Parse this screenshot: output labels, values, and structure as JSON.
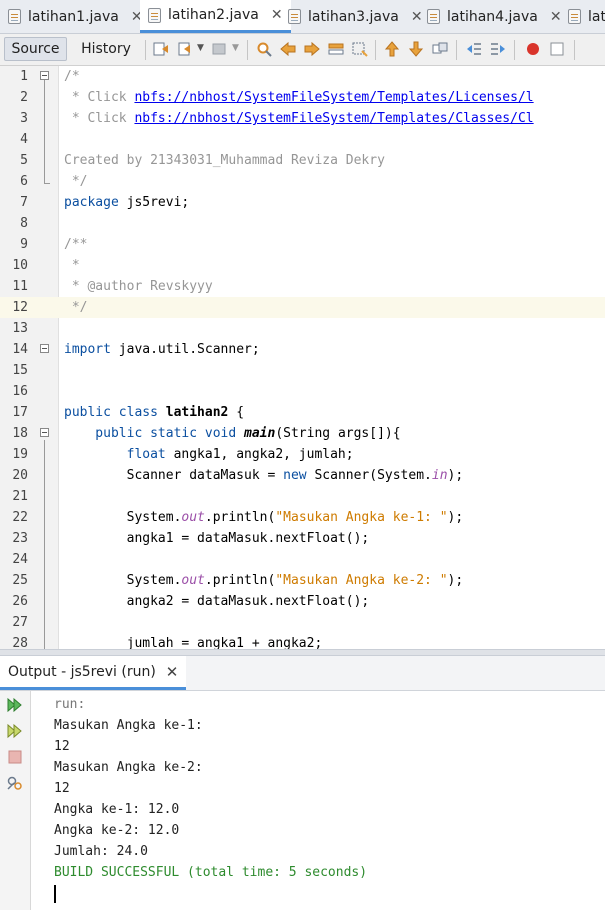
{
  "tabs": [
    {
      "label": "latihan1.java",
      "active": false
    },
    {
      "label": "latihan2.java",
      "active": true
    },
    {
      "label": "latihan3.java",
      "active": false
    },
    {
      "label": "latihan4.java",
      "active": false
    },
    {
      "label": "lat",
      "active": false
    }
  ],
  "toolbar": {
    "source_label": "Source",
    "history_label": "History",
    "icons": [
      "last-edit-icon",
      "back-icon",
      "forward-icon",
      "find-icon",
      "find-prev-icon",
      "find-next-icon",
      "find-selection-icon",
      "toggle-highlight-icon",
      "prev-bookmark-icon",
      "next-bookmark-icon",
      "toggle-bookmark-icon",
      "shift-left-icon",
      "shift-right-icon",
      "record-macro-icon",
      "stop-macro-icon"
    ]
  },
  "editor": {
    "lines": [
      {
        "n": "1"
      },
      {
        "n": "2"
      },
      {
        "n": "3"
      },
      {
        "n": "4"
      },
      {
        "n": "5"
      },
      {
        "n": "6"
      },
      {
        "n": "7"
      },
      {
        "n": "8"
      },
      {
        "n": "9"
      },
      {
        "n": "10"
      },
      {
        "n": "11"
      },
      {
        "n": "12"
      },
      {
        "n": "13"
      },
      {
        "n": "14"
      },
      {
        "n": "15"
      },
      {
        "n": "16"
      },
      {
        "n": "17"
      },
      {
        "n": "18"
      },
      {
        "n": "19"
      },
      {
        "n": "20"
      },
      {
        "n": "21"
      },
      {
        "n": "22"
      },
      {
        "n": "23"
      },
      {
        "n": "24"
      },
      {
        "n": "25"
      },
      {
        "n": "26"
      },
      {
        "n": "27"
      },
      {
        "n": "28"
      }
    ],
    "code": {
      "l1": "/*",
      "l2_pre": " * Click ",
      "l2_link": "nbfs://nbhost/SystemFileSystem/Templates/Licenses/l",
      "l3_pre": " * Click ",
      "l3_link": "nbfs://nbhost/SystemFileSystem/Templates/Classes/Cl",
      "l5": "Created by 21343031_Muhammad Reviza Dekry",
      "l6": " */",
      "l7_kw": "package",
      "l7_rest": " js5revi;",
      "l9": "/**",
      "l10": " *",
      "l11": " * @author Revskyyy",
      "l12": " */",
      "l14_kw": "import",
      "l14_rest": " java.util.Scanner;",
      "l17_kw": "public class",
      "l17_name": " latihan2",
      "l17_rest": " {",
      "l18_kw": "    public static void",
      "l18_name": " main",
      "l18_rest": "(String args[]){",
      "l19_kw": "        float",
      "l19_rest": " angka1, angka2, jumlah;",
      "l20_a": "        Scanner dataMasuk = ",
      "l20_kw": "new",
      "l20_b": " Scanner(System.",
      "l20_st": "in",
      "l20_c": ");",
      "l22_a": "        System.",
      "l22_st": "out",
      "l22_b": ".println(",
      "l22_str": "\"Masukan Angka ke-1: \"",
      "l22_c": ");",
      "l23": "        angka1 = dataMasuk.nextFloat();",
      "l25_a": "        System.",
      "l25_st": "out",
      "l25_b": ".println(",
      "l25_str": "\"Masukan Angka ke-2: \"",
      "l25_c": ");",
      "l26": "        angka2 = dataMasuk.nextFloat();",
      "l28": "        jumlah = angka1 + angka2;"
    }
  },
  "output": {
    "tab_label": "Output - js5revi (run)",
    "lines": [
      "run:",
      "Masukan Angka ke-1:",
      "12",
      "Masukan Angka ke-2:",
      "12",
      "Angka ke-1: 12.0",
      "Angka ke-2: 12.0",
      "Jumlah: 24.0",
      "BUILD SUCCESSFUL (total time: 5 seconds)"
    ]
  },
  "colors": {
    "accent": "#4a8fd9",
    "keyword": "#0b4fa0",
    "string": "#ce7b00",
    "comment": "#969696",
    "success": "#2e8b2e"
  }
}
